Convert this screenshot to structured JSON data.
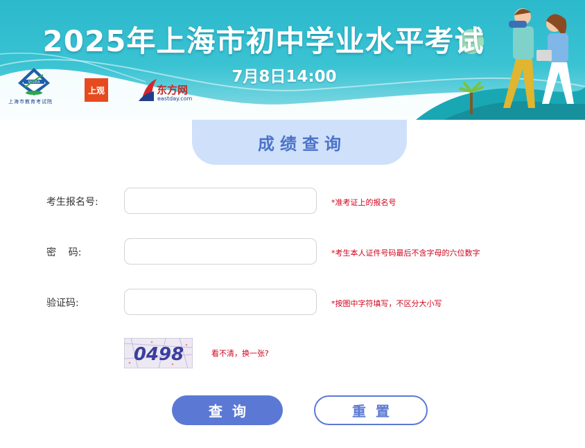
{
  "banner": {
    "title": "2025年上海市初中学业水平考试",
    "date": "7月8日14:00",
    "logos": {
      "seea_caption": "上海市教育考试院",
      "shangguan": "上观",
      "eastday_cn": "东方网",
      "eastday_en": "eastday.com"
    }
  },
  "form": {
    "heading": "成绩查询",
    "fields": [
      {
        "label": "考生报名号:",
        "value": "",
        "hint": "*准考证上的报名号"
      },
      {
        "label": "密    码:",
        "value": "",
        "hint": "*考生本人证件号码最后不含字母的六位数字"
      },
      {
        "label": "验证码:",
        "value": "",
        "hint": "*按图中字符填写，不区分大小写"
      }
    ],
    "captcha": {
      "code": "0498",
      "refresh_label": "看不清，换一张?"
    },
    "buttons": {
      "query": "查询",
      "reset": "重置"
    }
  },
  "colors": {
    "banner": "#2bb9cc",
    "heading_bg": "#cfe0fb",
    "heading_text": "#4b73c8",
    "button": "#5b79d4",
    "hint": "#d0021b"
  }
}
